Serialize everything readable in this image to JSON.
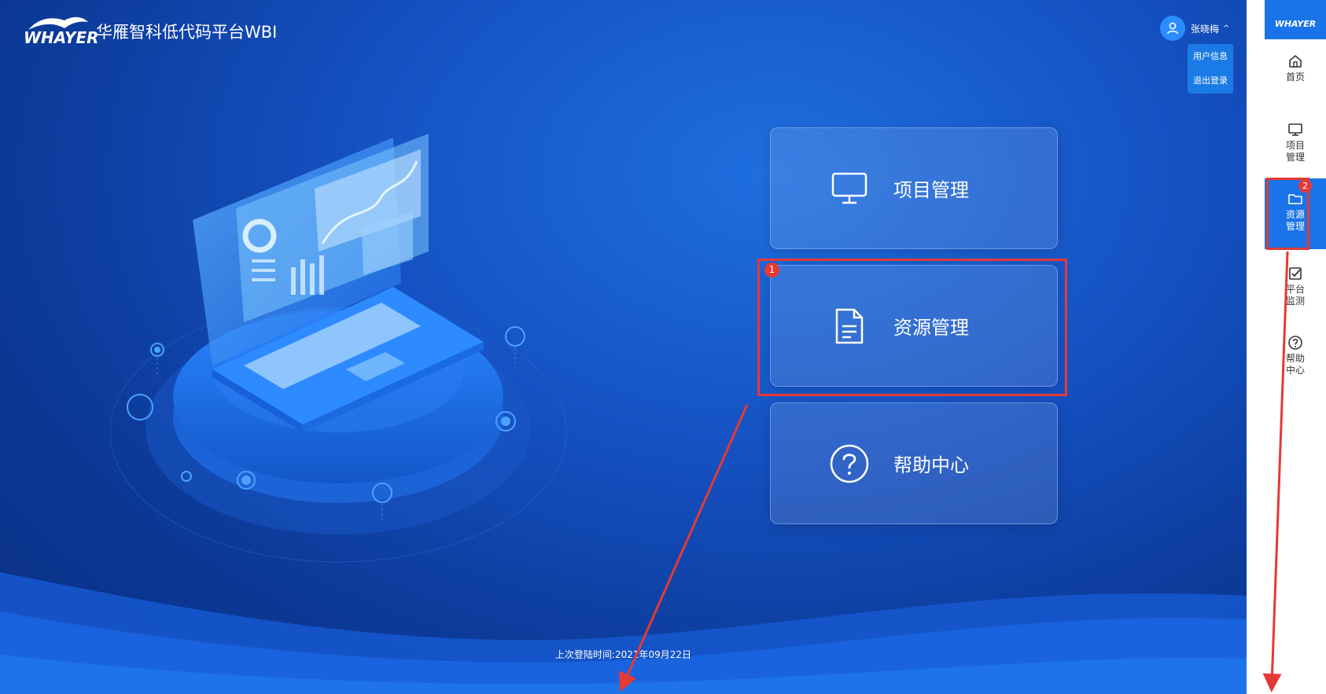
{
  "header": {
    "logo_text": "WHAYER",
    "app_title": "华雁智科低代码平台WBI"
  },
  "user": {
    "name": "张晓梅",
    "caret": "^",
    "menu": [
      "用户信息",
      "退出登录"
    ]
  },
  "cards": [
    {
      "label": "项目管理",
      "icon": "monitor-icon"
    },
    {
      "label": "资源管理",
      "icon": "document-icon"
    },
    {
      "label": "帮助中心",
      "icon": "question-circle-icon"
    }
  ],
  "footer": {
    "last_login": "上次登陆时间:2021年09月22日"
  },
  "sidebar": {
    "logo_text": "WHAYER",
    "items": [
      {
        "label": "首页",
        "icon": "home-icon"
      },
      {
        "label": "项目管理",
        "icon": "monitor-icon"
      },
      {
        "label": "资源管理",
        "icon": "folder-icon",
        "active": true
      },
      {
        "label": "平台监测",
        "icon": "checkbox-icon"
      },
      {
        "label": "帮助中心",
        "icon": "question-circle-icon"
      }
    ]
  },
  "annotations": {
    "badge_1": "1",
    "badge_2": "2"
  },
  "colors": {
    "background": "#1551c2",
    "accent": "#1a73e8",
    "highlight": "#e53935"
  }
}
